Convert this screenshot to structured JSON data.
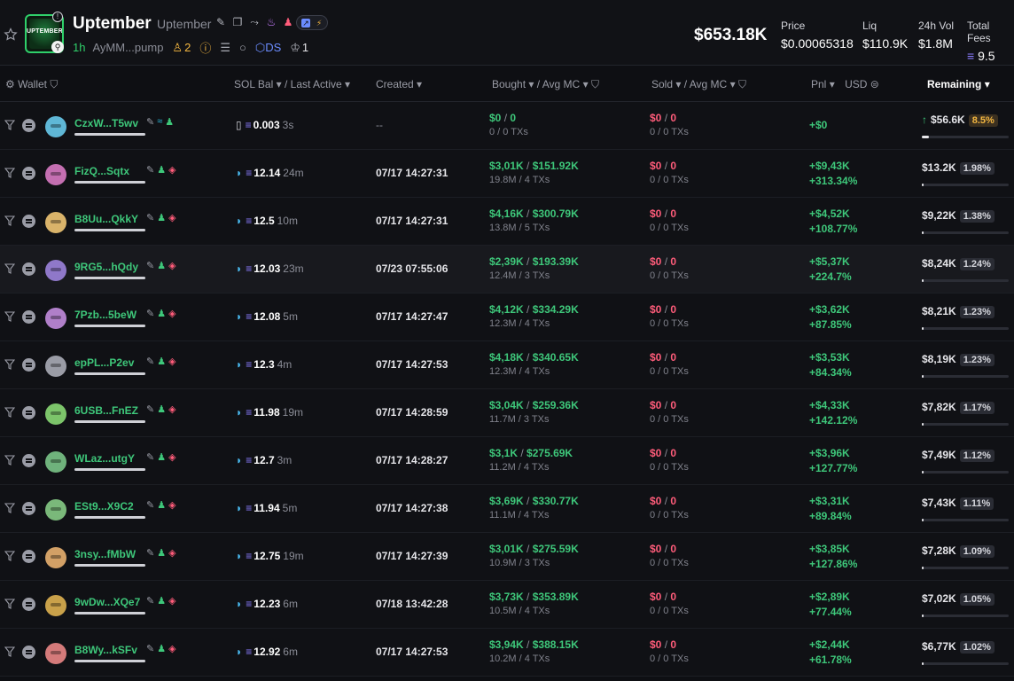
{
  "token": {
    "name": "Uptember",
    "ticker": "Uptember",
    "logo_text": "UPTEMBER",
    "age": "1h",
    "address": "AyMM...pump",
    "holders_count": "2",
    "ds_label": "DS",
    "tracking_count": "1",
    "market_cap": "$653.18K"
  },
  "stats": [
    {
      "label": "Price",
      "value": "$0.00065318"
    },
    {
      "label": "Liq",
      "value": "$110.9K"
    },
    {
      "label": "24h Vol",
      "value": "$1.8M"
    },
    {
      "label": "Total Fees",
      "value": "9.5"
    }
  ],
  "columns": {
    "wallet": "Wallet",
    "sol_bal": "SOL Bal",
    "last_active": "Last Active",
    "created": "Created",
    "bought": "Bought",
    "avg_mc": "Avg MC",
    "sold": "Sold",
    "sold_avg_mc": "Avg MC",
    "pnl": "Pnl",
    "usd": "USD",
    "remaining": "Remaining"
  },
  "rows": [
    {
      "wallet": "CzxW...T5wv",
      "avatar_color": "#5fb7d6",
      "sol": "0.003",
      "ago": "3s",
      "created": "--",
      "bought": "$0",
      "avg_mc": "0",
      "bought_sub": "0 / 0 TXs",
      "sold": "$0",
      "sold_avg": "0",
      "sold_sub": "0 / 0 TXs",
      "pnl": "+$0",
      "pnl_pct": "",
      "remaining": "$56.6K",
      "pct": "8.5%",
      "fill": 0.085
    },
    {
      "wallet": "FizQ...Sqtx",
      "avatar_color": "#c46fb1",
      "sol": "12.14",
      "ago": "24m",
      "created": "07/17 14:27:31",
      "bought": "$3,01K",
      "avg_mc": "$151.92K",
      "bought_sub": "19.8M / 4 TXs",
      "sold": "$0",
      "sold_avg": "0",
      "sold_sub": "0 / 0 TXs",
      "pnl": "+$9,43K",
      "pnl_pct": "+313.34%",
      "remaining": "$13.2K",
      "pct": "1.98%",
      "fill": 0.0198
    },
    {
      "wallet": "B8Uu...QkkY",
      "avatar_color": "#d9b36a",
      "sol": "12.5",
      "ago": "10m",
      "created": "07/17 14:27:31",
      "bought": "$4,16K",
      "avg_mc": "$300.79K",
      "bought_sub": "13.8M / 5 TXs",
      "sold": "$0",
      "sold_avg": "0",
      "sold_sub": "0 / 0 TXs",
      "pnl": "+$4,52K",
      "pnl_pct": "+108.77%",
      "remaining": "$9,22K",
      "pct": "1.38%",
      "fill": 0.0138
    },
    {
      "wallet": "9RG5...hQdy",
      "avatar_color": "#8f78c9",
      "sol": "12.03",
      "ago": "23m",
      "created": "07/23 07:55:06",
      "bought": "$2,39K",
      "avg_mc": "$193.39K",
      "bought_sub": "12.4M / 3 TXs",
      "sold": "$0",
      "sold_avg": "0",
      "sold_sub": "0 / 0 TXs",
      "pnl": "+$5,37K",
      "pnl_pct": "+224.7%",
      "remaining": "$8,24K",
      "pct": "1.24%",
      "fill": 0.0124
    },
    {
      "wallet": "7Pzb...5beW",
      "avatar_color": "#b07fc9",
      "sol": "12.08",
      "ago": "5m",
      "created": "07/17 14:27:47",
      "bought": "$4,12K",
      "avg_mc": "$334.29K",
      "bought_sub": "12.3M / 4 TXs",
      "sold": "$0",
      "sold_avg": "0",
      "sold_sub": "0 / 0 TXs",
      "pnl": "+$3,62K",
      "pnl_pct": "+87.85%",
      "remaining": "$8,21K",
      "pct": "1.23%",
      "fill": 0.0123
    },
    {
      "wallet": "epPL...P2ev",
      "avatar_color": "#9a9ca6",
      "sol": "12.3",
      "ago": "4m",
      "created": "07/17 14:27:53",
      "bought": "$4,18K",
      "avg_mc": "$340.65K",
      "bought_sub": "12.3M / 4 TXs",
      "sold": "$0",
      "sold_avg": "0",
      "sold_sub": "0 / 0 TXs",
      "pnl": "+$3,53K",
      "pnl_pct": "+84.34%",
      "remaining": "$8,19K",
      "pct": "1.23%",
      "fill": 0.0123
    },
    {
      "wallet": "6USB...FnEZ",
      "avatar_color": "#7cc46a",
      "sol": "11.98",
      "ago": "19m",
      "created": "07/17 14:28:59",
      "bought": "$3,04K",
      "avg_mc": "$259.36K",
      "bought_sub": "11.7M / 3 TXs",
      "sold": "$0",
      "sold_avg": "0",
      "sold_sub": "0 / 0 TXs",
      "pnl": "+$4,33K",
      "pnl_pct": "+142.12%",
      "remaining": "$7,82K",
      "pct": "1.17%",
      "fill": 0.0117
    },
    {
      "wallet": "WLaz...utgY",
      "avatar_color": "#6fb27c",
      "sol": "12.7",
      "ago": "3m",
      "created": "07/17 14:28:27",
      "bought": "$3,1K",
      "avg_mc": "$275.69K",
      "bought_sub": "11.2M / 4 TXs",
      "sold": "$0",
      "sold_avg": "0",
      "sold_sub": "0 / 0 TXs",
      "pnl": "+$3,96K",
      "pnl_pct": "+127.77%",
      "remaining": "$7,49K",
      "pct": "1.12%",
      "fill": 0.0112
    },
    {
      "wallet": "ESt9...X9C2",
      "avatar_color": "#7ab87a",
      "sol": "11.94",
      "ago": "5m",
      "created": "07/17 14:27:38",
      "bought": "$3,69K",
      "avg_mc": "$330.77K",
      "bought_sub": "11.1M / 4 TXs",
      "sold": "$0",
      "sold_avg": "0",
      "sold_sub": "0 / 0 TXs",
      "pnl": "+$3,31K",
      "pnl_pct": "+89.84%",
      "remaining": "$7,43K",
      "pct": "1.11%",
      "fill": 0.0111
    },
    {
      "wallet": "3nsy...fMbW",
      "avatar_color": "#d2a066",
      "sol": "12.75",
      "ago": "19m",
      "created": "07/17 14:27:39",
      "bought": "$3,01K",
      "avg_mc": "$275.59K",
      "bought_sub": "10.9M / 3 TXs",
      "sold": "$0",
      "sold_avg": "0",
      "sold_sub": "0 / 0 TXs",
      "pnl": "+$3,85K",
      "pnl_pct": "+127.86%",
      "remaining": "$7,28K",
      "pct": "1.09%",
      "fill": 0.0109
    },
    {
      "wallet": "9wDw...XQe7",
      "avatar_color": "#c9a14a",
      "sol": "12.23",
      "ago": "6m",
      "created": "07/18 13:42:28",
      "bought": "$3,73K",
      "avg_mc": "$353.89K",
      "bought_sub": "10.5M / 4 TXs",
      "sold": "$0",
      "sold_avg": "0",
      "sold_sub": "0 / 0 TXs",
      "pnl": "+$2,89K",
      "pnl_pct": "+77.44%",
      "remaining": "$7,02K",
      "pct": "1.05%",
      "fill": 0.0105
    },
    {
      "wallet": "B8Wy...kSFv",
      "avatar_color": "#d47a7a",
      "sol": "12.92",
      "ago": "6m",
      "created": "07/17 14:27:53",
      "bought": "$3,94K",
      "avg_mc": "$388.15K",
      "bought_sub": "10.2M / 4 TXs",
      "sold": "$0",
      "sold_avg": "0",
      "sold_sub": "0 / 0 TXs",
      "pnl": "+$2,44K",
      "pnl_pct": "+61.78%",
      "remaining": "$6,77K",
      "pct": "1.02%",
      "fill": 0.0102
    }
  ],
  "colors": {
    "accent_green": "#3ec77a",
    "loss_red": "#ff5c7a",
    "background": "#0e0f13"
  }
}
